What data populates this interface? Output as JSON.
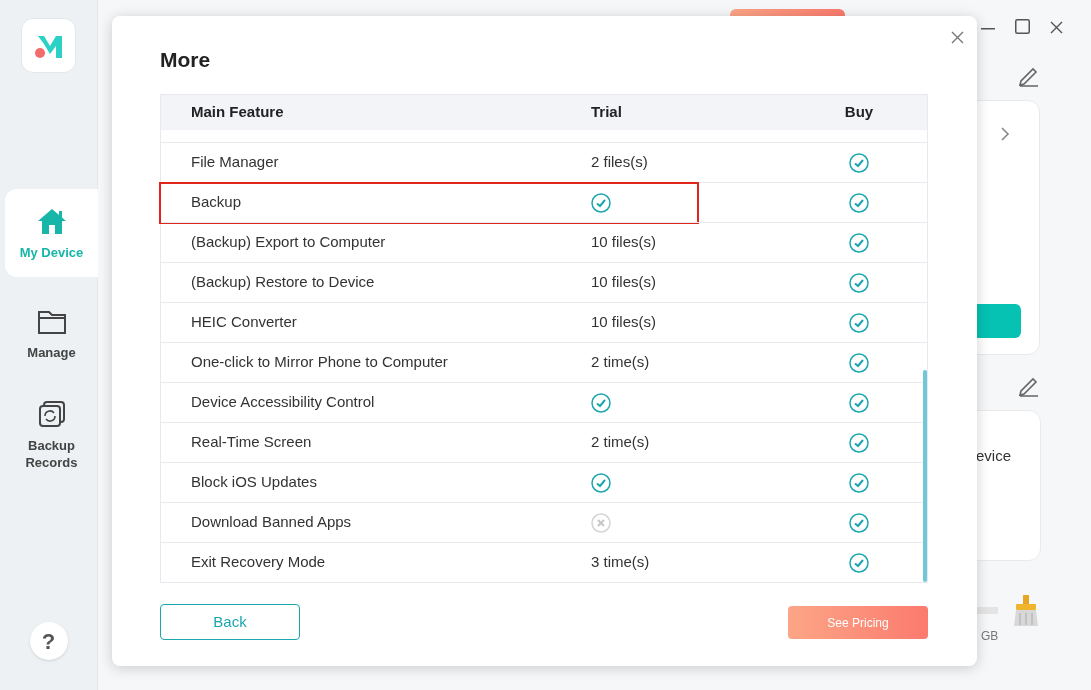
{
  "sidebar": {
    "items": [
      {
        "label": "My Device",
        "selected": true
      },
      {
        "label": "Manage",
        "selected": false
      },
      {
        "label": "Backup Records",
        "selected": false
      }
    ],
    "help": "?"
  },
  "background": {
    "device_text": "evice",
    "storage_text": "GB"
  },
  "dialog": {
    "title": "More",
    "table": {
      "columns": [
        "Main Feature",
        "Trial",
        "Buy"
      ],
      "rows": [
        {
          "feature": "File Manager",
          "trial": {
            "kind": "text",
            "text": "2 files(s)"
          },
          "buy": true,
          "highlighted": false
        },
        {
          "feature": "Backup",
          "trial": {
            "kind": "check"
          },
          "buy": true,
          "highlighted": true
        },
        {
          "feature": "(Backup) Export to Computer",
          "trial": {
            "kind": "text",
            "text": "10 files(s)"
          },
          "buy": true,
          "highlighted": false
        },
        {
          "feature": "(Backup) Restore to Device",
          "trial": {
            "kind": "text",
            "text": "10 files(s)"
          },
          "buy": true,
          "highlighted": false
        },
        {
          "feature": "HEIC Converter",
          "trial": {
            "kind": "text",
            "text": "10 files(s)"
          },
          "buy": true,
          "highlighted": false
        },
        {
          "feature": "One-click to Mirror Phone to Computer",
          "trial": {
            "kind": "text",
            "text": "2 time(s)"
          },
          "buy": true,
          "highlighted": false
        },
        {
          "feature": "Device Accessibility Control",
          "trial": {
            "kind": "check"
          },
          "buy": true,
          "highlighted": false
        },
        {
          "feature": "Real-Time Screen",
          "trial": {
            "kind": "text",
            "text": "2 time(s)"
          },
          "buy": true,
          "highlighted": false
        },
        {
          "feature": "Block iOS Updates",
          "trial": {
            "kind": "check"
          },
          "buy": true,
          "highlighted": false
        },
        {
          "feature": "Download Banned Apps",
          "trial": {
            "kind": "cross"
          },
          "buy": true,
          "highlighted": false
        },
        {
          "feature": "Exit Recovery Mode",
          "trial": {
            "kind": "text",
            "text": "3 time(s)"
          },
          "buy": true,
          "highlighted": false
        }
      ]
    },
    "buttons": {
      "back": "Back",
      "pricing": "See Pricing"
    }
  }
}
